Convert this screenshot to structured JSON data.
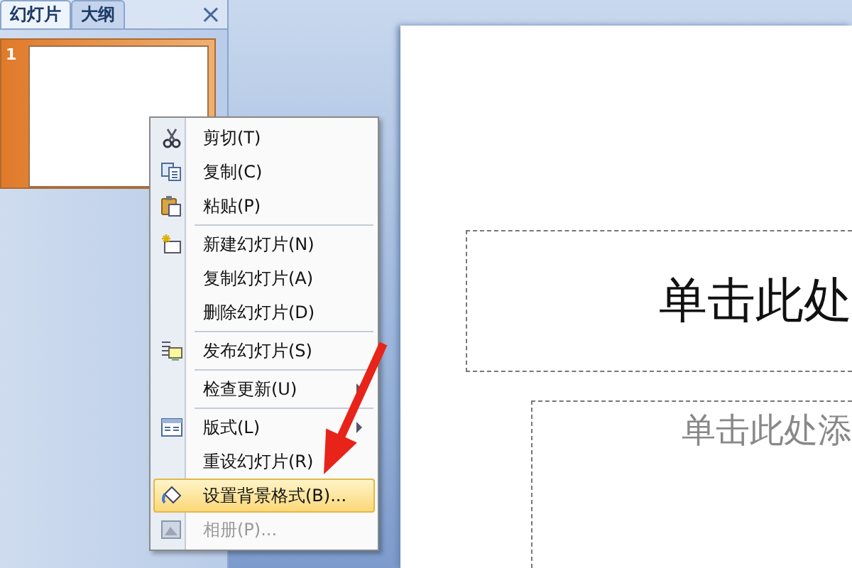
{
  "panel": {
    "tabs": [
      {
        "label": "幻灯片",
        "selected": true
      },
      {
        "label": "大纲",
        "selected": false
      }
    ],
    "close": "×",
    "slides": [
      {
        "number": "1",
        "selected": true
      }
    ]
  },
  "slide": {
    "title": "单击此处",
    "subtitle": "单击此处添"
  },
  "context_menu": {
    "items": [
      {
        "label": "剪切(T)",
        "separator_before": false,
        "submenu": false,
        "disabled": false,
        "selected": false
      },
      {
        "label": "复制(C)",
        "separator_before": false,
        "submenu": false,
        "disabled": false,
        "selected": false
      },
      {
        "label": "粘贴(P)",
        "separator_before": false,
        "submenu": false,
        "disabled": false,
        "selected": false
      },
      {
        "label": "新建幻灯片(N)",
        "separator_before": true,
        "submenu": false,
        "disabled": false,
        "selected": false
      },
      {
        "label": "复制幻灯片(A)",
        "separator_before": false,
        "submenu": false,
        "disabled": false,
        "selected": false
      },
      {
        "label": "删除幻灯片(D)",
        "separator_before": false,
        "submenu": false,
        "disabled": false,
        "selected": false
      },
      {
        "label": "发布幻灯片(S)",
        "separator_before": true,
        "submenu": false,
        "disabled": false,
        "selected": false
      },
      {
        "label": "检查更新(U)",
        "separator_before": true,
        "submenu": true,
        "disabled": false,
        "selected": false
      },
      {
        "label": "版式(L)",
        "separator_before": true,
        "submenu": true,
        "disabled": false,
        "selected": false
      },
      {
        "label": "重设幻灯片(R)",
        "separator_before": false,
        "submenu": false,
        "disabled": false,
        "selected": false
      },
      {
        "label": "设置背景格式(B)...",
        "separator_before": false,
        "submenu": false,
        "disabled": false,
        "selected": true
      },
      {
        "label": "相册(P)...",
        "separator_before": false,
        "submenu": false,
        "disabled": true,
        "selected": false
      }
    ]
  }
}
